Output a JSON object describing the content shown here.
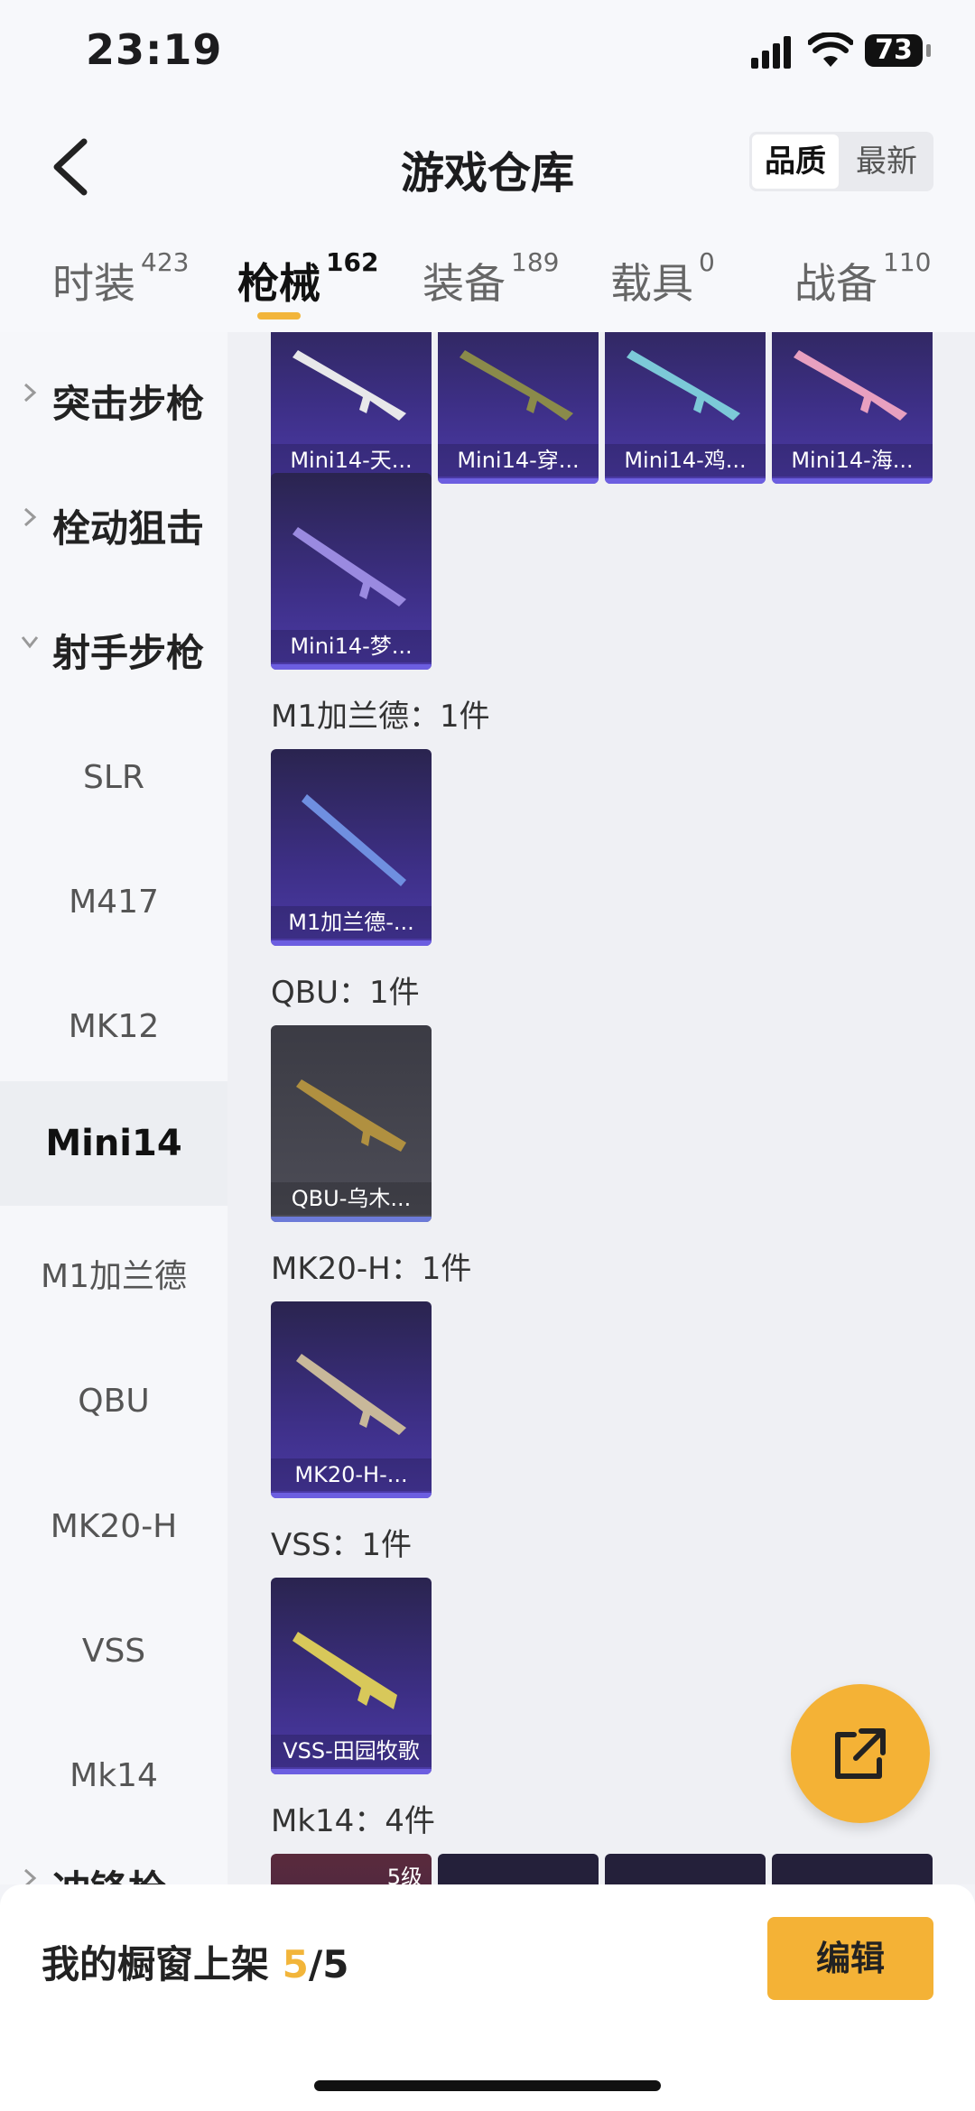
{
  "status": {
    "time": "23:19",
    "battery": "73"
  },
  "header": {
    "title": "游戏仓库",
    "sort_options": [
      "品质",
      "最新"
    ]
  },
  "tabs": [
    {
      "label": "时装",
      "count": "423"
    },
    {
      "label": "枪械",
      "count": "162"
    },
    {
      "label": "装备",
      "count": "189"
    },
    {
      "label": "载具",
      "count": "0"
    },
    {
      "label": "战备",
      "count": "110"
    }
  ],
  "sidebar": {
    "categories": [
      "突击步枪",
      "栓动狙击",
      "射手步枪",
      "冲锋枪"
    ],
    "subitems": [
      "SLR",
      "M417",
      "MK12",
      "Mini14",
      "M1加兰德",
      "QBU",
      "MK20-H",
      "VSS",
      "Mk14"
    ]
  },
  "groups": {
    "mini14_row1": [
      "Mini14-天...",
      "Mini14-穿...",
      "Mini14-鸡...",
      "Mini14-海..."
    ],
    "mini14_row2": [
      "Mini14-梦..."
    ],
    "m1": {
      "label": "M1加兰德：1件",
      "items": [
        "M1加兰德-..."
      ]
    },
    "qbu": {
      "label": "QBU：1件",
      "items": [
        "QBU-乌木..."
      ]
    },
    "mk20": {
      "label": "MK20-H：1件",
      "items": [
        "MK20-H-..."
      ]
    },
    "vss": {
      "label": "VSS：1件",
      "items": [
        "VSS-田园牧歌"
      ]
    },
    "mk14": {
      "label": "Mk14：4件",
      "level_badge": "5级"
    }
  },
  "bottom": {
    "shelf_label": "我的橱窗上架",
    "shelf_current": "5",
    "shelf_total": "/5",
    "edit_label": "编辑"
  },
  "colors": {
    "accent": "#f2b53a",
    "card_purple": "#3d2f86"
  }
}
